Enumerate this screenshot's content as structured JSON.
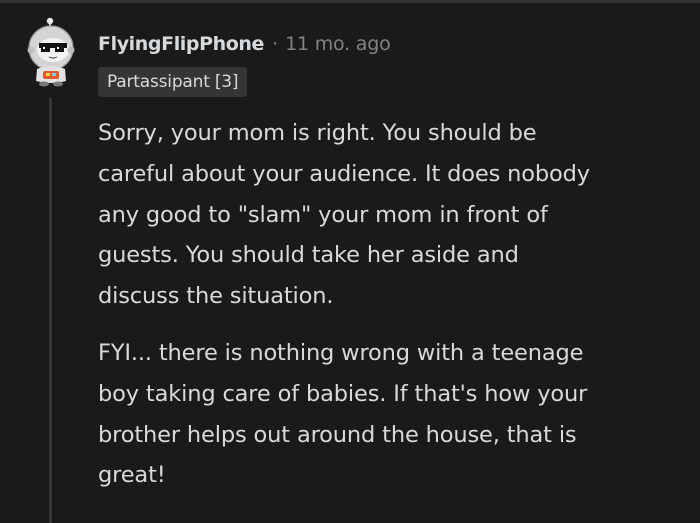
{
  "comment": {
    "username": "FlyingFlipPhone",
    "separator": "·",
    "timestamp": "11 mo. ago",
    "flair": "Partassipant [3]",
    "paragraphs": [
      {
        "lines": [
          "Sorry, your mom is right. You should be",
          "careful about your audience. It does nobody",
          "any good to \"slam\" your mom in front of",
          "guests. You should take her aside and",
          "discuss the situation."
        ]
      },
      {
        "lines": [
          "FYI... there is nothing wrong with a teenage",
          "boy taking care of babies. If that's how your",
          "brother helps out around the house, that is",
          "great!"
        ]
      }
    ]
  },
  "colors": {
    "background": "#1a1a1b",
    "text": "#d7dadc",
    "meta": "#818384",
    "flair_bg": "#343536",
    "thread_line": "#343536"
  },
  "icons": {
    "avatar": "snoo-astronaut-sunglasses-avatar"
  }
}
